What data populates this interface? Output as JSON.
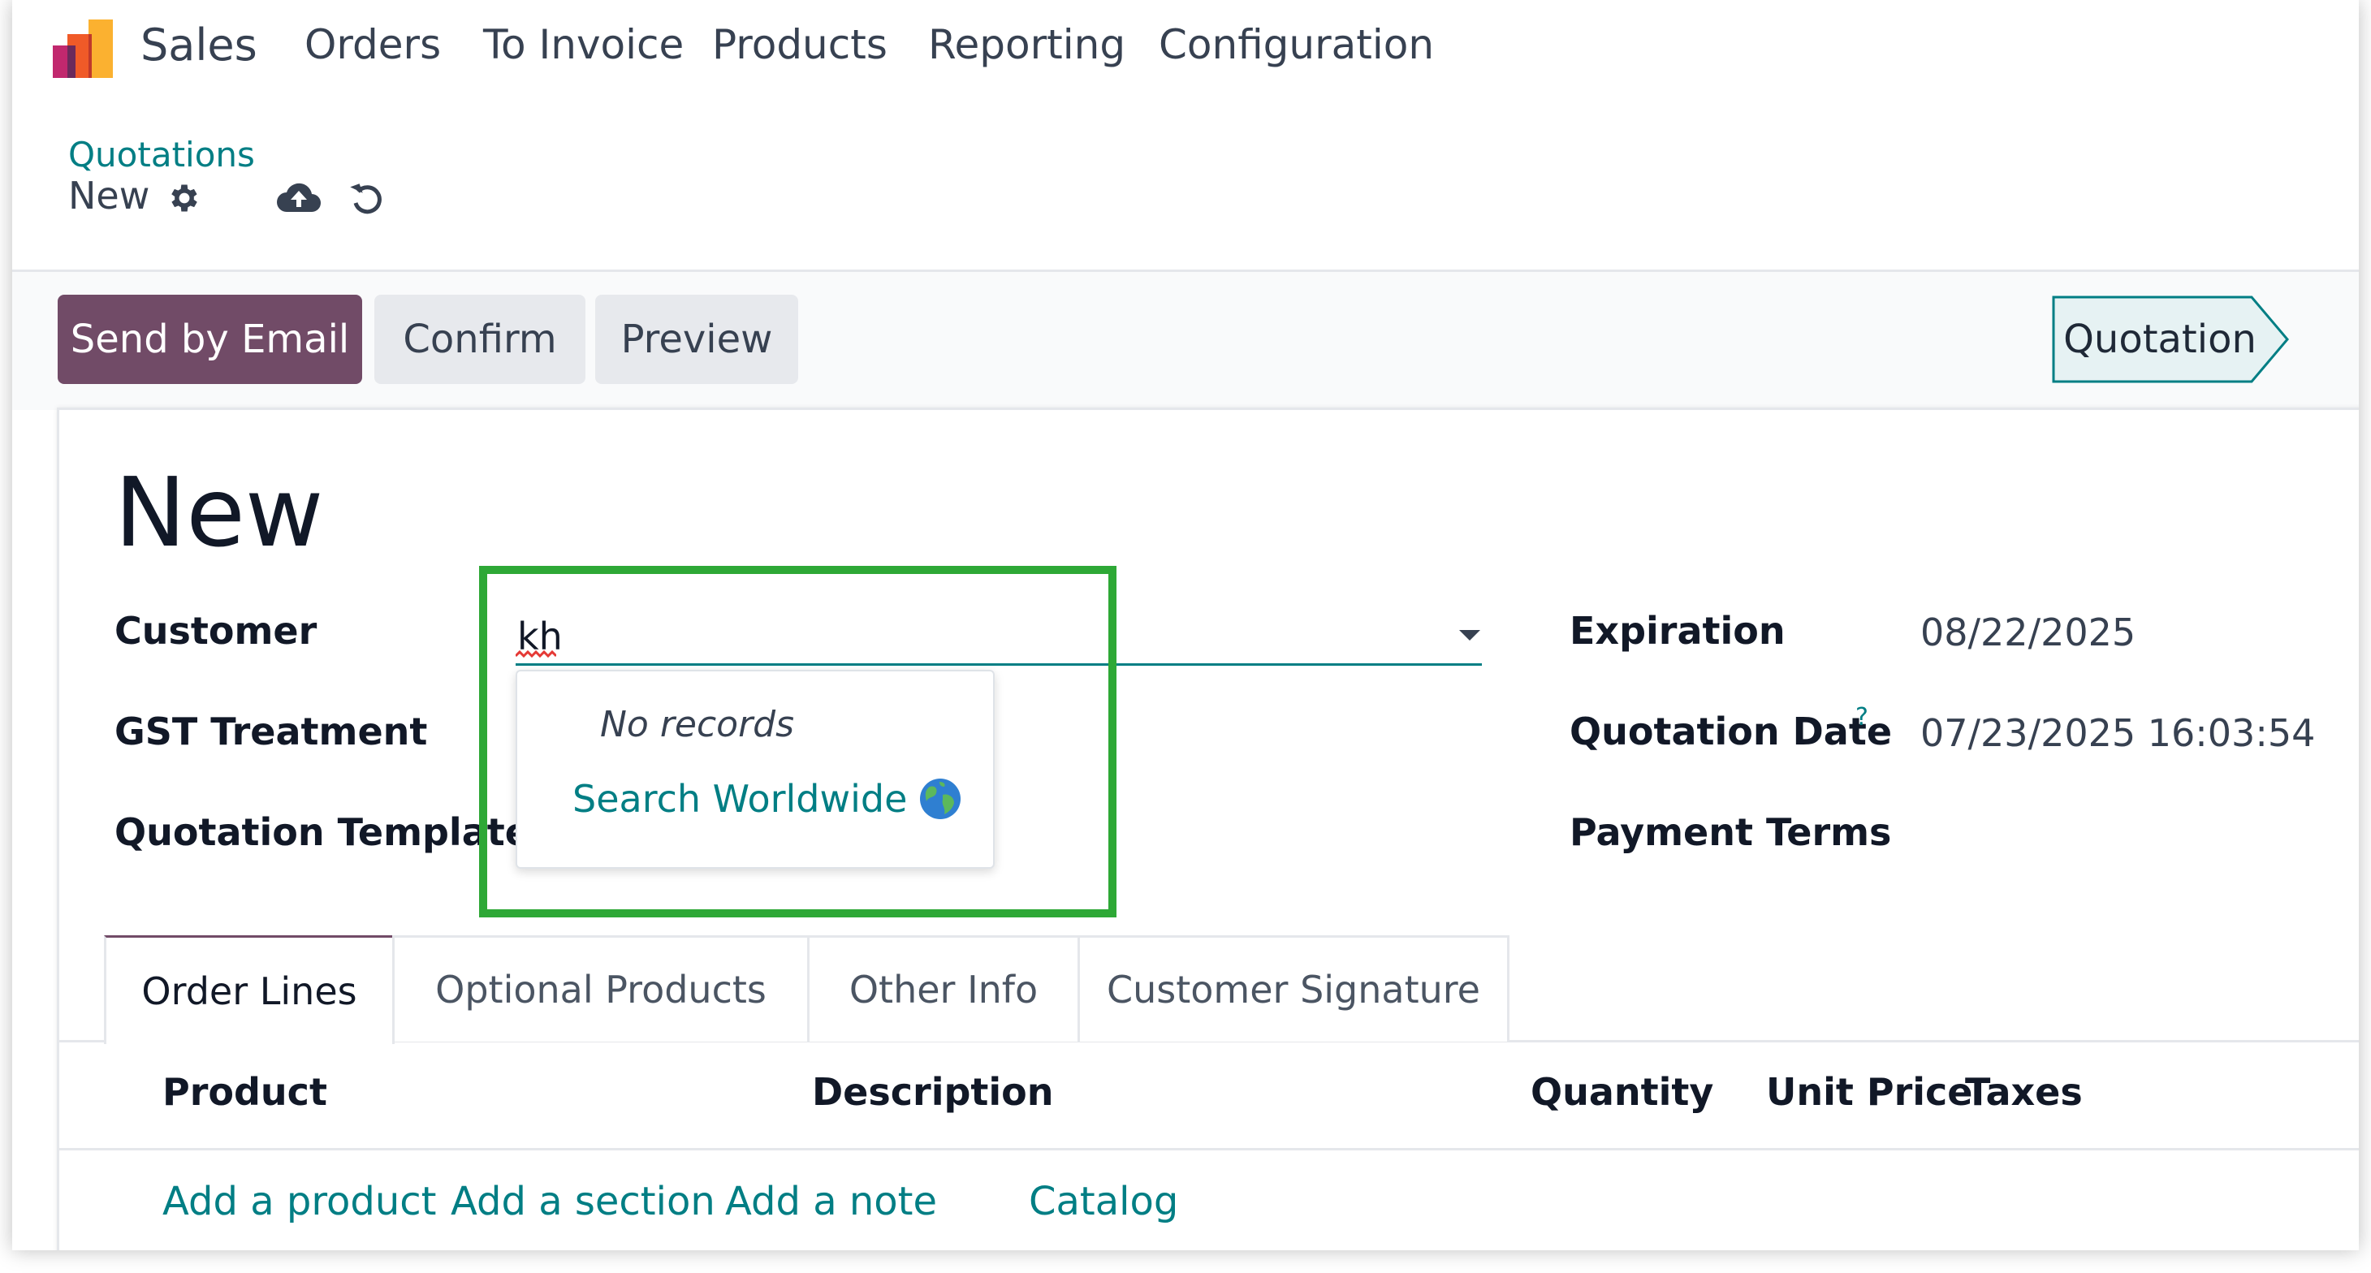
{
  "navbar": {
    "app_name": "Sales",
    "menu": [
      "Orders",
      "To Invoice",
      "Products",
      "Reporting",
      "Configuration"
    ]
  },
  "breadcrumb": {
    "parent": "Quotations",
    "current": "New"
  },
  "actions": {
    "send_email": "Send by Email",
    "confirm": "Confirm",
    "preview": "Preview"
  },
  "status": {
    "stage": "Quotation"
  },
  "form": {
    "title": "New",
    "fields_left": {
      "customer_label": "Customer",
      "customer_value": "kh",
      "gst_label": "GST Treatment",
      "template_label": "Quotation Template"
    },
    "fields_right": {
      "expiration_label": "Expiration",
      "expiration_value": "08/22/2025",
      "quotation_date_label": "Quotation Date",
      "quotation_date_help": "?",
      "quotation_date_value": "07/23/2025 16:03:54",
      "payment_terms_label": "Payment Terms"
    },
    "autocomplete": {
      "no_records": "No records",
      "search_worldwide": "Search Worldwide"
    }
  },
  "tabs": [
    "Order Lines",
    "Optional Products",
    "Other Info",
    "Customer Signature"
  ],
  "order_lines": {
    "columns": [
      "Product",
      "Description",
      "Quantity",
      "Unit Price",
      "Taxes"
    ],
    "links": [
      "Add a product",
      "Add a section",
      "Add a note",
      "Catalog"
    ]
  },
  "colors": {
    "primary": "#714b67",
    "link": "#017e84",
    "highlight": "#2ea836"
  }
}
